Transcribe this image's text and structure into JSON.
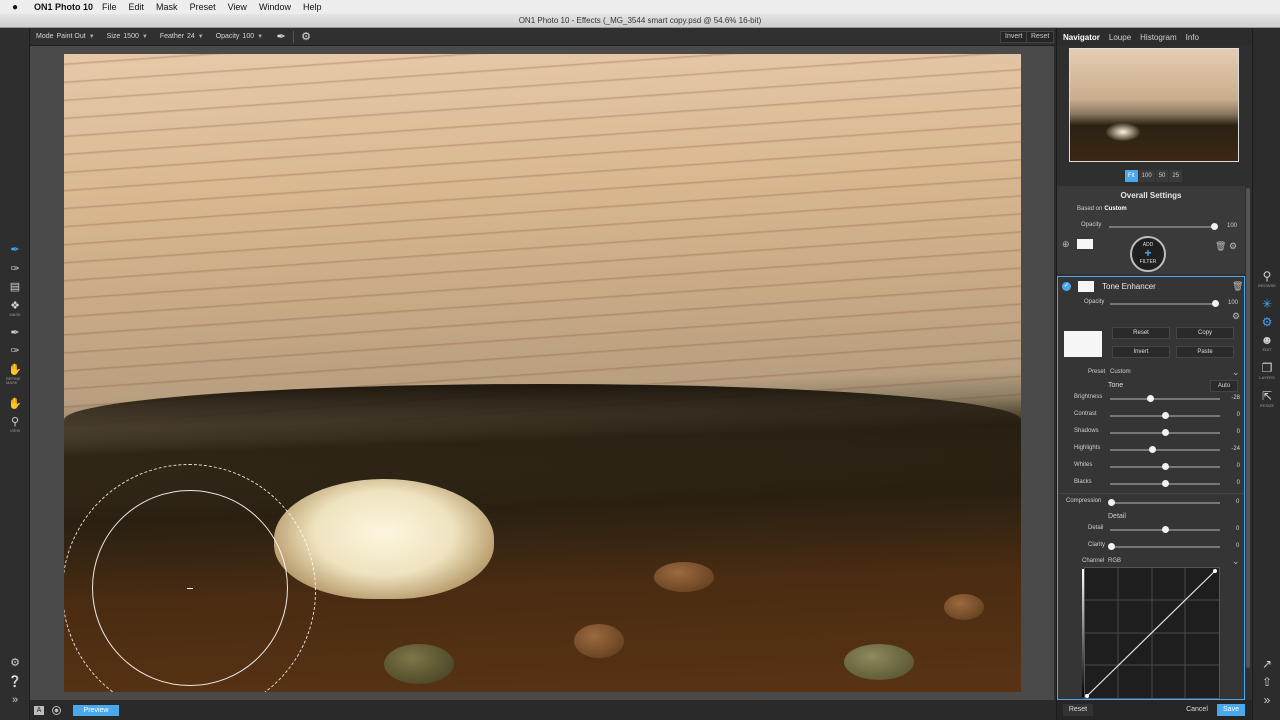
{
  "menubar": {
    "apple": "",
    "app_name": "ON1 Photo 10",
    "menus": [
      "File",
      "Edit",
      "Mask",
      "Preset",
      "View",
      "Window",
      "Help"
    ]
  },
  "window": {
    "title": "ON1 Photo 10 - Effects (_MG_3544 smart copy.psd @ 54.6% 16-bit)"
  },
  "options_bar": {
    "mode_label": "Mode",
    "mode_value": "Paint Out",
    "size_label": "Size",
    "size_value": "1500",
    "feather_label": "Feather",
    "feather_value": "24",
    "opacity_label": "Opacity",
    "opacity_value": "100",
    "invert_label": "Invert",
    "reset_label": "Reset"
  },
  "left_tools": {
    "mask_label": "MASK",
    "refine_label": "REFINE MASK",
    "view_label": "VIEW"
  },
  "bottom_bar": {
    "a_label": "A",
    "preview_label": "Preview"
  },
  "navigator": {
    "tabs": [
      "Navigator",
      "Loupe",
      "Histogram",
      "Info"
    ],
    "zoom": [
      "Fit",
      "100",
      "50",
      "25"
    ]
  },
  "overall": {
    "title": "Overall Settings",
    "based_on_label": "Based on",
    "based_on_value": "Custom",
    "opacity_label": "Opacity",
    "opacity_value": "100",
    "add_label": "ADD",
    "filter_label": "FILTER"
  },
  "filter": {
    "name": "Tone Enhancer",
    "opacity_label": "Opacity",
    "opacity_value": "100",
    "reset_label": "Reset",
    "copy_label": "Copy",
    "invert_label": "Invert",
    "paste_label": "Paste",
    "preset_label": "Preset",
    "preset_value": "Custom",
    "tone_title": "Tone",
    "auto_label": "Auto",
    "tone_sliders": [
      {
        "label": "Brightness",
        "value": "-28",
        "pos": 0.36
      },
      {
        "label": "Contrast",
        "value": "0",
        "pos": 0.5
      },
      {
        "label": "Shadows",
        "value": "0",
        "pos": 0.5
      },
      {
        "label": "Highlights",
        "value": "-24",
        "pos": 0.38
      },
      {
        "label": "Whites",
        "value": "0",
        "pos": 0.5
      },
      {
        "label": "Blacks",
        "value": "0",
        "pos": 0.5
      }
    ],
    "compression_label": "Compression",
    "compression_value": "0",
    "detail_title": "Detail",
    "detail_label": "Detail",
    "detail_value": "0",
    "clarity_label": "Clarity",
    "clarity_value": "0",
    "channel_label": "Channel",
    "channel_value": "RGB"
  },
  "panel_bottom": {
    "reset_label": "Reset",
    "cancel_label": "Cancel",
    "save_label": "Save"
  },
  "modules": {
    "browse": "BROWSE",
    "edit": "EDIT",
    "layers": "LAYERS",
    "resize": "RESIZE"
  },
  "colors": {
    "accent": "#4aa9ec"
  }
}
